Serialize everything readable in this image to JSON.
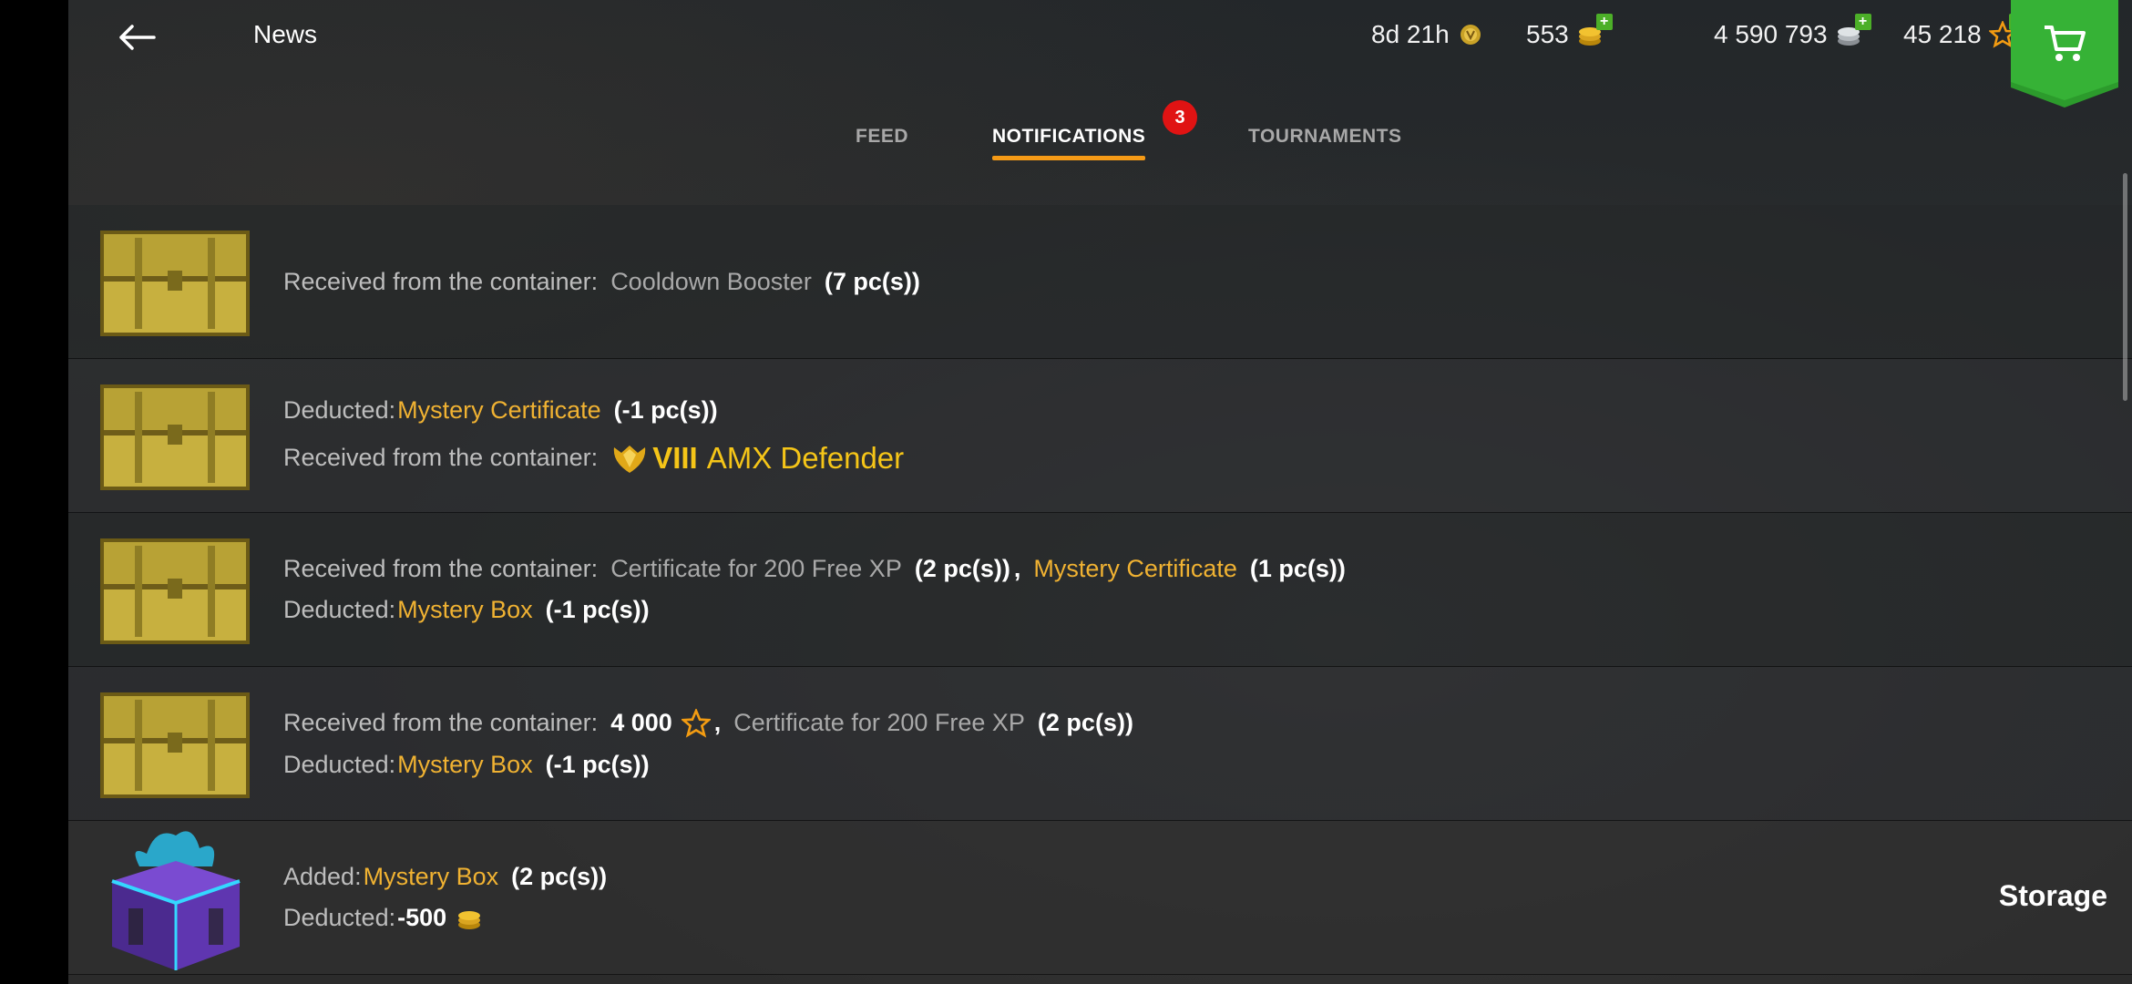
{
  "header": {
    "title": "News",
    "timer": "8d 21h",
    "gold": "553",
    "credits": "4 590 793",
    "free_xp": "45 218"
  },
  "tabs": [
    {
      "label": "FEED",
      "active": false
    },
    {
      "label": "NOTIFICATIONS",
      "active": true
    },
    {
      "label": "TOURNAMENTS",
      "active": false
    }
  ],
  "notification_badge": "3",
  "notifications": [
    {
      "lines": [
        {
          "label": "Received from the container:",
          "item": "Cooldown Booster",
          "qty": "(7 pc(s))"
        }
      ]
    },
    {
      "lines": [
        {
          "label": "Deducted:",
          "item": "Mystery Certificate",
          "qty": "(-1 pc(s))"
        },
        {
          "label": "Received from the container:",
          "tier": "VIII",
          "vehicle": "AMX Defender"
        }
      ]
    },
    {
      "lines": [
        {
          "label": "Received from the container:",
          "item": "Certificate for 200 Free XP",
          "qty": "(2 pc(s))",
          "item2": "Mystery Certificate",
          "qty2": "(1 pc(s))"
        },
        {
          "label": "Deducted:",
          "item": "Mystery Box",
          "qty": "(-1 pc(s))"
        }
      ]
    },
    {
      "lines": [
        {
          "label": "Received from the container:",
          "amount": "4 000",
          "item": "Certificate for 200 Free XP",
          "qty": "(2 pc(s))"
        },
        {
          "label": "Deducted:",
          "item": "Mystery Box",
          "qty": "(-1 pc(s))"
        }
      ]
    },
    {
      "lines": [
        {
          "label": "Added:",
          "item": "Mystery Box",
          "qty": "(2 pc(s))"
        },
        {
          "label": "Deducted:",
          "amount": "-500"
        }
      ],
      "action": "Storage"
    }
  ],
  "colors": {
    "accent_orange": "#f59a16",
    "item_gold": "#f0b232",
    "shop_green": "#2c9b2c",
    "badge_red": "#e01313"
  },
  "icons": [
    "arrow-left-icon",
    "trophy-icon",
    "gold-coins-icon",
    "silver-coins-icon",
    "star-icon",
    "cart-icon",
    "chest-icon",
    "mystery-box-icon",
    "tier-emblem-icon"
  ]
}
